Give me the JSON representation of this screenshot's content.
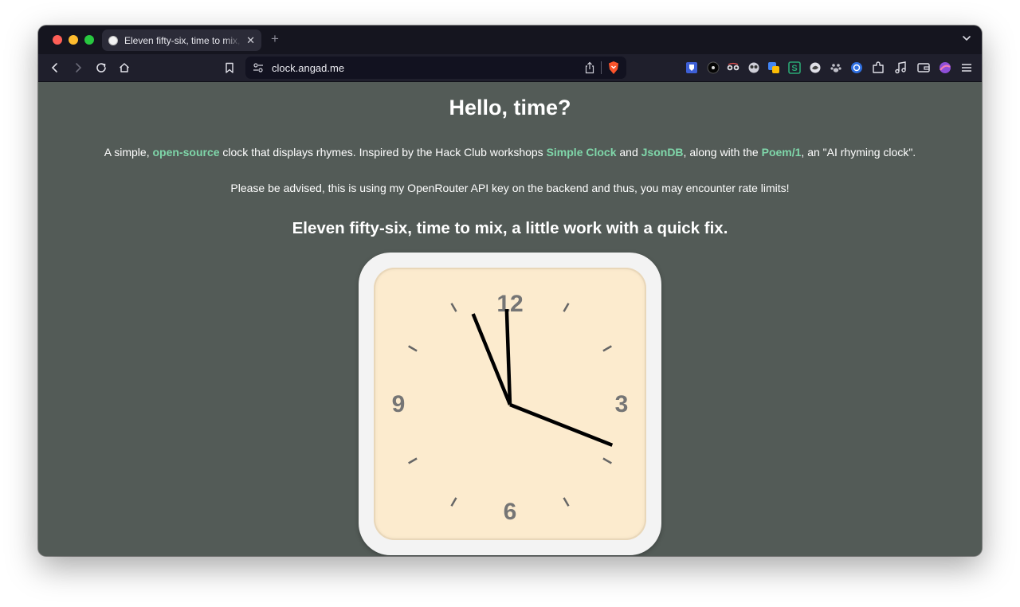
{
  "browser": {
    "tab": {
      "title": "Eleven fifty-six, time to mix, a little work with a quick fix.",
      "favicon": "clock-icon"
    },
    "address_bar": {
      "url": "clock.angad.me"
    },
    "toolbar_icons": [
      "back-icon",
      "forward-icon",
      "reload-icon",
      "home-icon",
      "bookmark-icon",
      "site-settings-icon",
      "share-icon",
      "brave-shields-icon"
    ],
    "extensions": [
      "bitwarden-icon",
      "dark-circle-icon",
      "glasses-icon",
      "owl-icon",
      "translate-icon",
      "s-extension-icon",
      "bird-icon",
      "paw-icon",
      "vpn-shield-icon",
      "extensions-puzzle-icon",
      "music-icon",
      "wallet-icon",
      "profile-avatar-icon",
      "menu-icon"
    ]
  },
  "page": {
    "title": "Hello, time?",
    "intro": {
      "before": "A simple, ",
      "link1": "open-source",
      "mid1": " clock that displays rhymes. Inspired by the Hack Club workshops ",
      "link2": "Simple Clock",
      "mid2": " and ",
      "link3": "JsonDB",
      "mid3": ", along with the ",
      "link4": "Poem/1",
      "after": ", an \"AI rhyming clock\"."
    },
    "notice": "Please be advised, this is using my OpenRouter API key on the backend and thus, you may encounter rate limits!",
    "rhyme": "Eleven fifty-six, time to mix, a little work with a quick fix.",
    "clock": {
      "numbers": {
        "n12": "12",
        "n3": "3",
        "n6": "6",
        "n9": "9"
      },
      "hours": 11,
      "minutes": 56,
      "seconds": 18.6
    }
  },
  "colors": {
    "page_background": "#535b57",
    "link": "#7fd6a9",
    "clock_face": "#fcebce",
    "clock_frame": "#f3f3f3",
    "hand": "#000000",
    "numerals": "#757575"
  }
}
